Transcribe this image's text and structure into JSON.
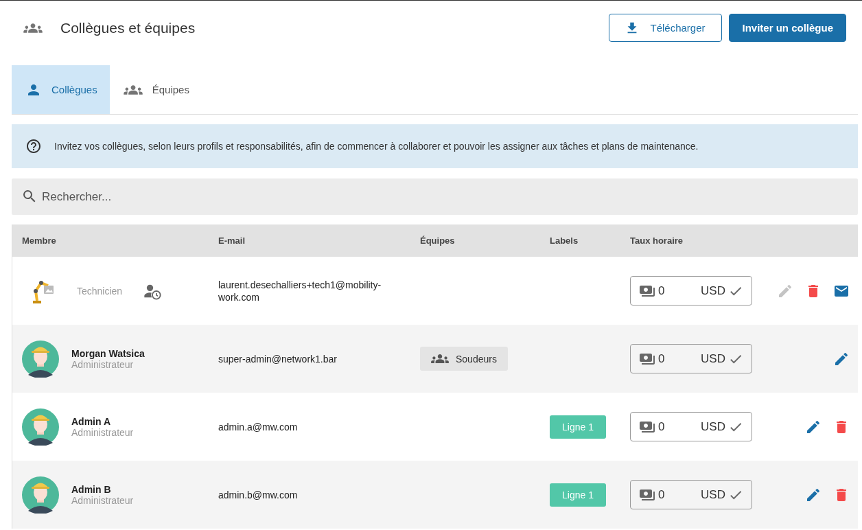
{
  "header": {
    "title": "Collègues et équipes",
    "buttons": [
      {
        "kind": "download",
        "label": "Télécharger"
      },
      {
        "kind": "primary",
        "label": "Inviter un collègue"
      }
    ]
  },
  "tabs": [
    {
      "label": "Collègues",
      "kind": "person",
      "selected": true
    },
    {
      "label": "Équipes",
      "kind": "group",
      "selected": false
    }
  ],
  "info": "Invitez vos collègues, selon leurs profils et responsabilités, afin de commencer à collaborer et pouvoir les assigner aux tâches et plans de maintenance.",
  "search": {
    "placeholder": "Rechercher..."
  },
  "table": {
    "columns": [
      "Membre",
      "E-mail",
      "Équipes",
      "Labels",
      "Taux horaire"
    ],
    "rows": [
      {
        "kind": "robot",
        "role": "Technicien",
        "pending": true,
        "email": "laurent.desechalliers+tech1@mobility-work.com",
        "rate": "0",
        "currency": "USD",
        "actions": [
          {
            "kind": "edit",
            "disabled": true
          },
          {
            "kind": "delete",
            "disabled": false
          },
          {
            "kind": "mail",
            "disabled": false
          }
        ]
      },
      {
        "kind": "worker",
        "name": "Morgan Watsica",
        "role": "Administrateur",
        "pending": false,
        "email": "super-admin@network1.bar",
        "team": "Soudeurs",
        "rate": "0",
        "currency": "USD",
        "actions": [
          {
            "kind": "edit",
            "disabled": false
          }
        ]
      },
      {
        "kind": "worker",
        "name": "Admin A",
        "role": "Administrateur",
        "pending": false,
        "email": "admin.a@mw.com",
        "label": "Ligne 1",
        "rate": "0",
        "currency": "USD",
        "actions": [
          {
            "kind": "edit",
            "disabled": false
          },
          {
            "kind": "delete",
            "disabled": false
          }
        ]
      },
      {
        "kind": "worker",
        "name": "Admin B",
        "role": "Administrateur",
        "pending": false,
        "email": "admin.b@mw.com",
        "label": "Ligne 1",
        "rate": "0",
        "currency": "USD",
        "actions": [
          {
            "kind": "edit",
            "disabled": false
          },
          {
            "kind": "delete",
            "disabled": false
          }
        ]
      }
    ]
  }
}
